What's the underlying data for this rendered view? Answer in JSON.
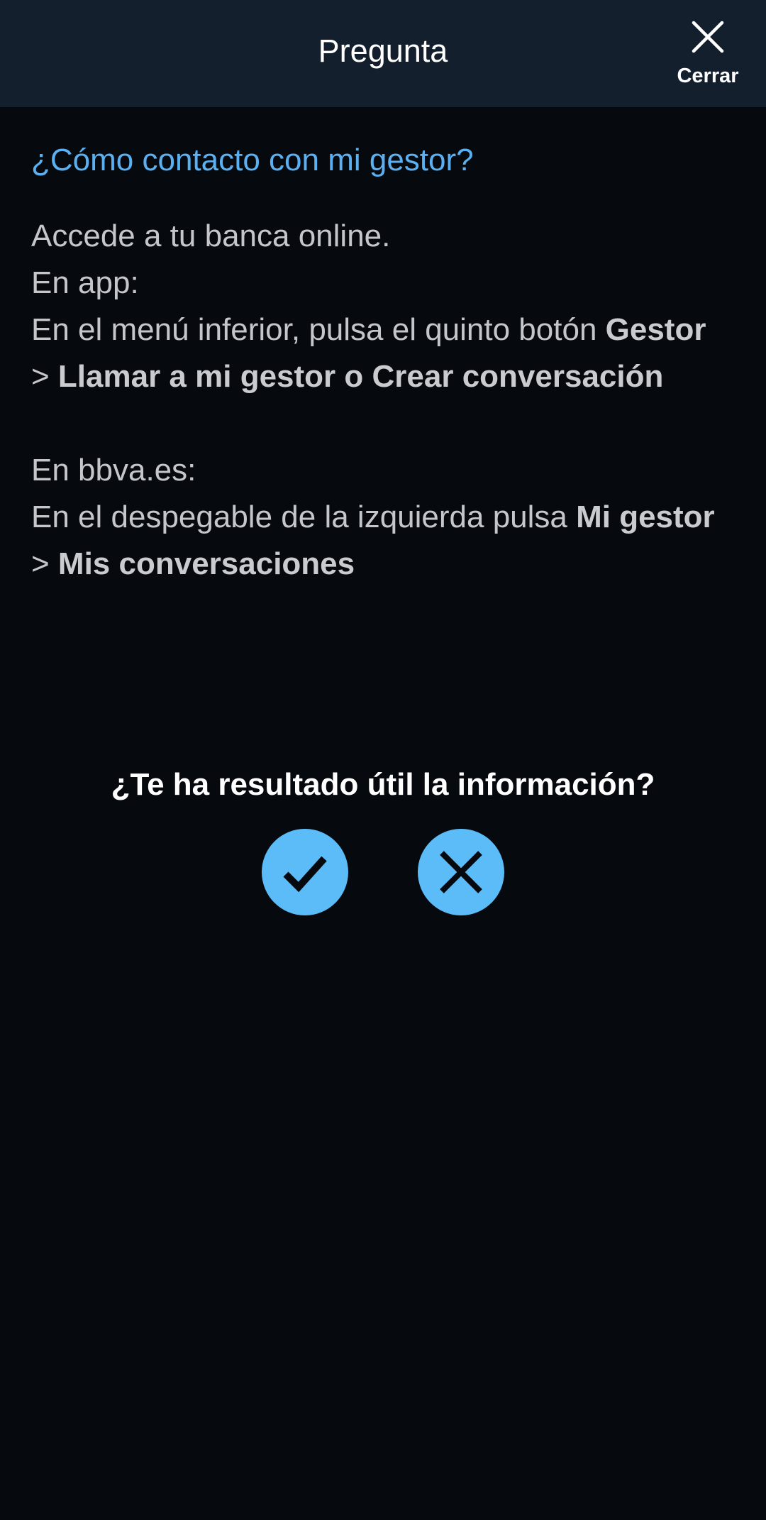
{
  "header": {
    "title": "Pregunta",
    "close_label": "Cerrar",
    "close_icon": "close-icon"
  },
  "faq": {
    "question": "¿Cómo contacto con mi gestor?",
    "line1": "Accede a tu banca online.",
    "line2": "En app:",
    "line3_prefix": "En el menú inferior, pulsa el quinto botón ",
    "line3_bold": "Gestor",
    "line4_prefix": "> ",
    "line4_bold": "Llamar a mi gestor o Crear conversación",
    "line5": "En bbva.es:",
    "line6_prefix": "En el despegable de la izquierda pulsa ",
    "line6_bold": "Mi gestor",
    "line7_prefix": "> ",
    "line7_bold": "Mis conversaciones"
  },
  "feedback": {
    "question": "¿Te ha resultado útil la información?",
    "yes_icon": "checkmark-icon",
    "no_icon": "close-icon"
  },
  "colors": {
    "header_bg": "#131f2d",
    "page_bg": "#060a0f",
    "link_blue": "#5ab0f0",
    "button_blue": "#5bbcf8"
  }
}
